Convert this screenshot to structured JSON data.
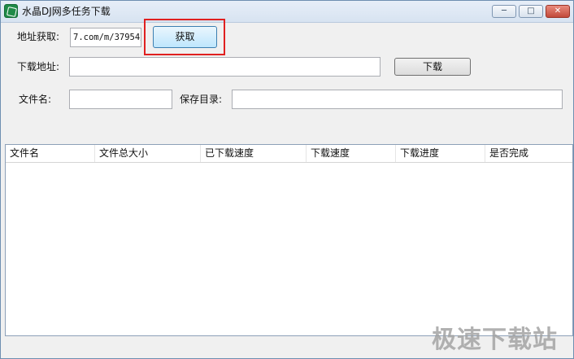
{
  "window": {
    "title": "水晶DJ网多任务下载"
  },
  "controls": {
    "minimize": "─",
    "maximize": "□",
    "close": "✕"
  },
  "form": {
    "address_fetch_label": "地址获取:",
    "address_fetch_value": "7.com/m/37954/",
    "fetch_button": "获取",
    "download_url_label": "下载地址:",
    "download_url_value": "",
    "download_button": "下载",
    "filename_label": "文件名:",
    "filename_value": "",
    "save_dir_label": "保存目录:",
    "save_dir_value": ""
  },
  "table": {
    "columns": [
      "文件名",
      "文件总大小",
      "已下载速度",
      "下载速度",
      "下载进度",
      "是否完成"
    ]
  },
  "watermark": "极速下载站"
}
